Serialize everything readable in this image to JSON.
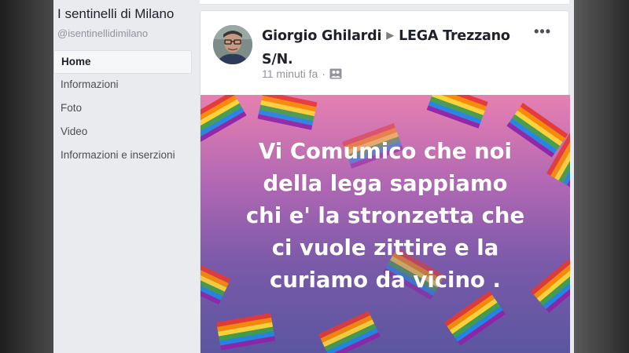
{
  "sidebar": {
    "page_name": "I sentinelli di Milano",
    "page_handle": "@isentinellidimilano",
    "items": [
      {
        "label": "Home",
        "active": true
      },
      {
        "label": "Informazioni",
        "active": false
      },
      {
        "label": "Foto",
        "active": false
      },
      {
        "label": "Video",
        "active": false
      },
      {
        "label": "Informazioni e inserzioni",
        "active": false
      }
    ]
  },
  "post": {
    "author": "Giorgio Ghilardi",
    "target": "LEGA  Trezzano S/N.",
    "time": "11 minuti fa",
    "separator": "·",
    "audience_icon": "friends-audience-icon",
    "more_icon": "more-options-icon",
    "more_label": "•••",
    "image_text": "Vi Comumico che noi\ndella lega sappiamo\nchi e' la stronzetta che\nci  vuole zittire e la\ncuriamo da vicino ."
  },
  "colors": {
    "image_top": "#e780b1",
    "image_bottom": "#5b56a0",
    "text": "#ffffff"
  }
}
